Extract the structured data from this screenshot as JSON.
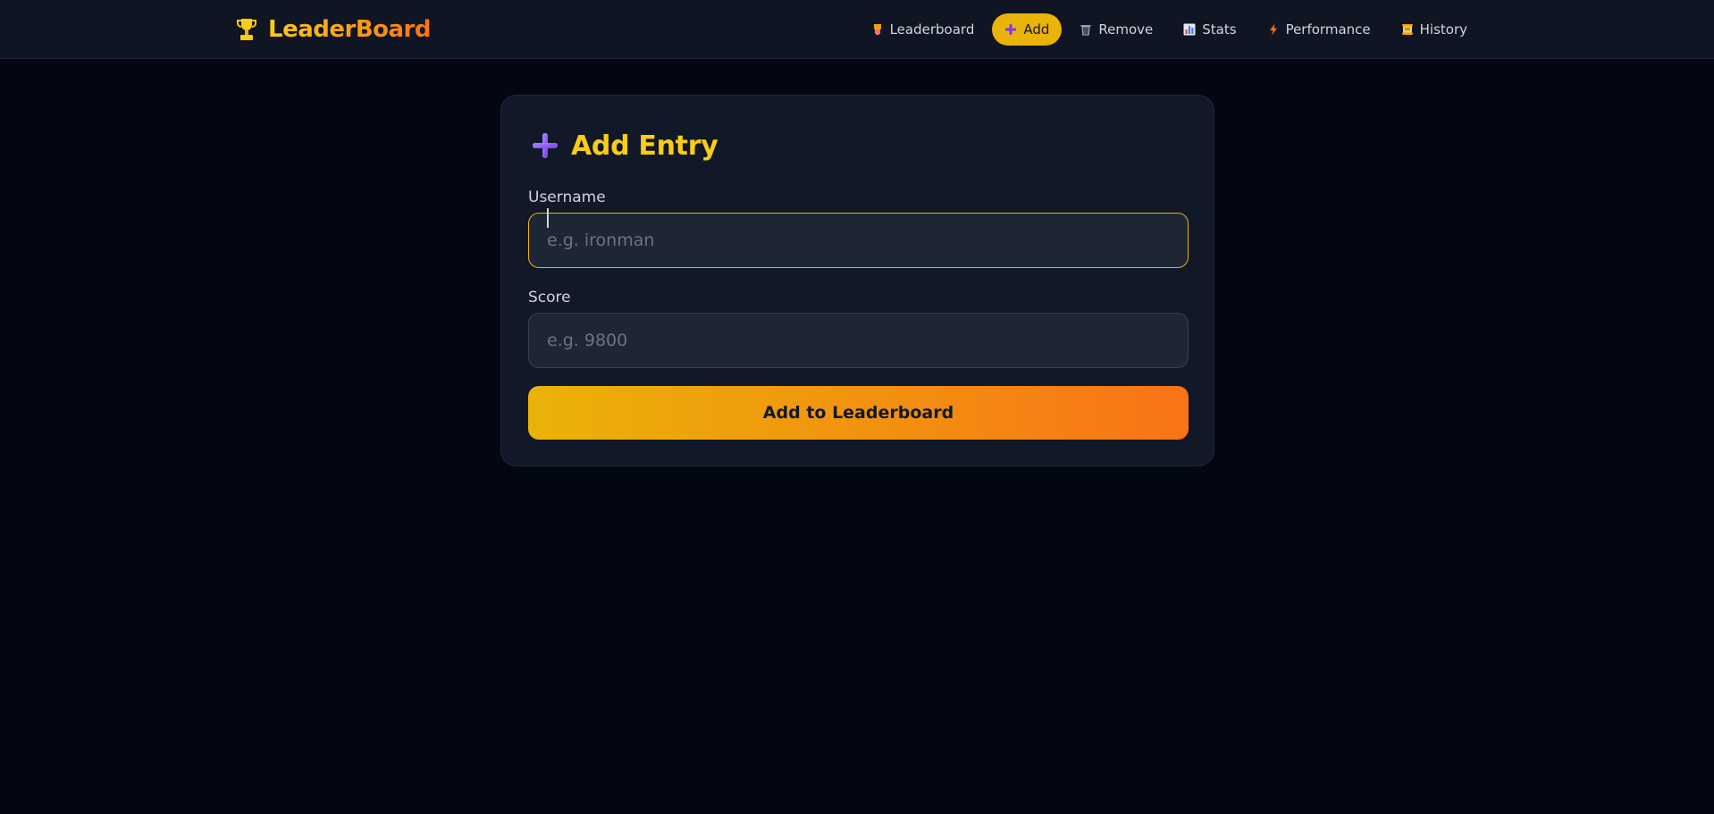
{
  "app": {
    "brand": "LeaderBoard",
    "brand_icon": "trophy-icon",
    "colors": {
      "background": "#030712",
      "accent": "#eab308",
      "accent_end": "#f97316"
    }
  },
  "nav": {
    "items": [
      {
        "label": "Leaderboard",
        "icon": "trophy-medal-icon",
        "active": false
      },
      {
        "label": "Add",
        "icon": "plus-icon",
        "active": true
      },
      {
        "label": "Remove",
        "icon": "trash-icon",
        "active": false
      },
      {
        "label": "Stats",
        "icon": "bar-chart-icon",
        "active": false
      },
      {
        "label": "Performance",
        "icon": "lightning-icon",
        "active": false
      },
      {
        "label": "History",
        "icon": "scroll-icon",
        "active": false
      }
    ]
  },
  "form": {
    "title": "Add Entry",
    "title_icon": "plus-icon",
    "username": {
      "label": "Username",
      "value": "",
      "placeholder": "e.g. ironman"
    },
    "score": {
      "label": "Score",
      "value": "",
      "placeholder": "e.g. 9800"
    },
    "submit_label": "Add to Leaderboard"
  }
}
